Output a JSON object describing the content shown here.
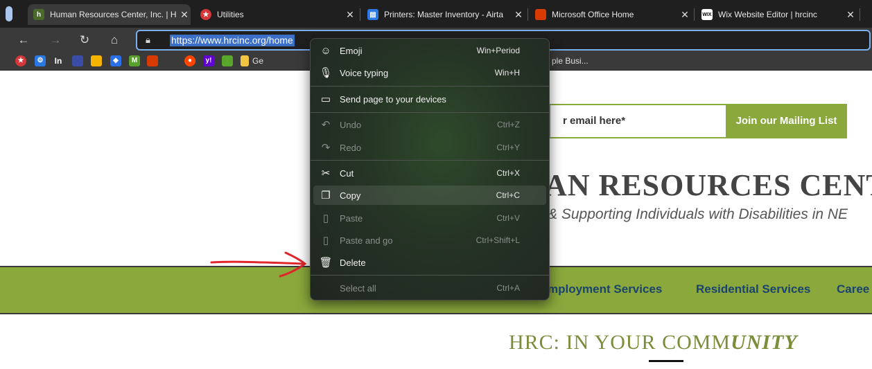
{
  "tabs": [
    {
      "label": "Human Resources Center, Inc. | H",
      "icon": "hrc-favicon",
      "closable": true
    },
    {
      "label": "Utilities",
      "icon": "utilities-favicon",
      "closable": true
    },
    {
      "label": "Printers: Master Inventory - Airta",
      "icon": "printer-favicon",
      "closable": true
    },
    {
      "label": "Microsoft Office Home",
      "icon": "office-favicon",
      "closable": true
    },
    {
      "label": "Wix Website Editor | hrcinc",
      "icon": "wix-favicon",
      "closable": true
    }
  ],
  "wix_badge": "WIX",
  "address_bar": {
    "url": "https://www.hrcinc.org/home"
  },
  "bookmarks": {
    "in_label": "In",
    "m_label": "M",
    "y_label": "y!",
    "partial_left": "Ge",
    "partial_right": "ple Busi..."
  },
  "context_menu": {
    "items": [
      {
        "label": "Emoji",
        "shortcut": "Win+Period",
        "icon": "emoji-icon",
        "enabled": true
      },
      {
        "label": "Voice typing",
        "shortcut": "Win+H",
        "icon": "microphone-icon",
        "enabled": true
      },
      {
        "label": "Send page to your devices",
        "shortcut": "",
        "icon": "devices-icon",
        "enabled": true
      },
      {
        "label": "Undo",
        "shortcut": "Ctrl+Z",
        "icon": "undo-icon",
        "enabled": false
      },
      {
        "label": "Redo",
        "shortcut": "Ctrl+Y",
        "icon": "redo-icon",
        "enabled": false
      },
      {
        "label": "Cut",
        "shortcut": "Ctrl+X",
        "icon": "scissors-icon",
        "enabled": true
      },
      {
        "label": "Copy",
        "shortcut": "Ctrl+C",
        "icon": "copy-icon",
        "enabled": true,
        "highlighted": true
      },
      {
        "label": "Paste",
        "shortcut": "Ctrl+V",
        "icon": "paste-icon",
        "enabled": false
      },
      {
        "label": "Paste and go",
        "shortcut": "Ctrl+Shift+L",
        "icon": "paste-go-icon",
        "enabled": false
      },
      {
        "label": "Delete",
        "shortcut": "",
        "icon": "trash-icon",
        "enabled": true
      },
      {
        "label": "Select all",
        "shortcut": "Ctrl+A",
        "icon": "",
        "enabled": false
      }
    ]
  },
  "page": {
    "email_placeholder": "r email here*",
    "join_button": "Join our Mailing List",
    "title": "AN RESOURCES CENTI",
    "subtitle": "& Supporting Individuals with Disabilities in NE",
    "nav": [
      "mployment Services",
      "Residential Services",
      "Caree"
    ],
    "heading_plain": "HRC: IN YOUR COMM",
    "heading_emph": "UNITY"
  },
  "colors": {
    "brand_green": "#8aa83c",
    "nav_text": "#1b4370",
    "annotation_red": "#e0262a"
  }
}
